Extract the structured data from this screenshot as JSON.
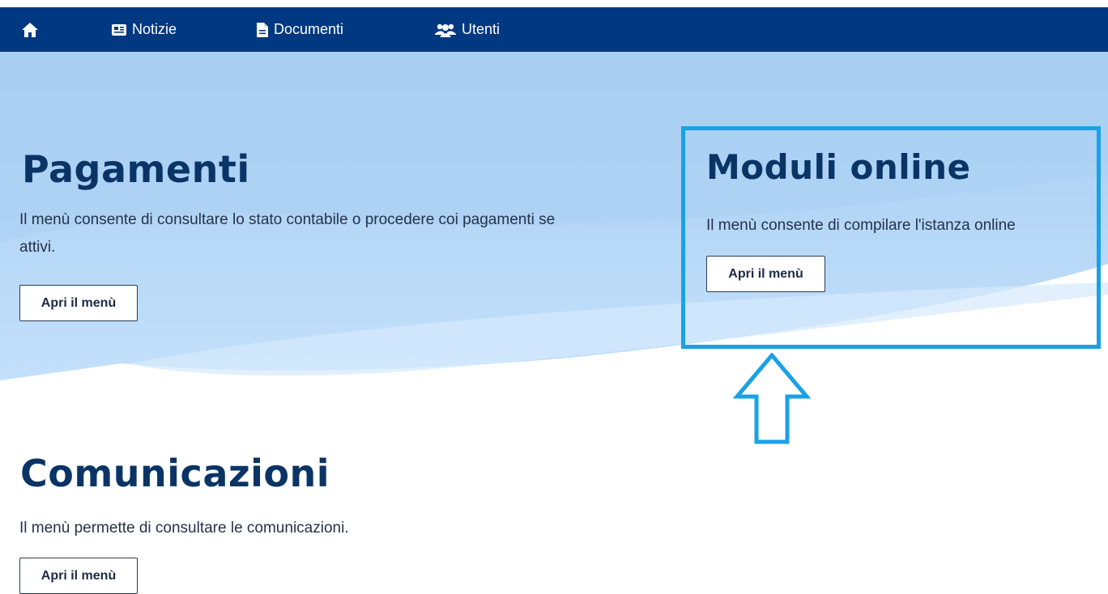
{
  "topbar": {
    "items": [
      {
        "icon": "home-icon",
        "label": ""
      },
      {
        "icon": "newspaper-icon",
        "label": "Notizie"
      },
      {
        "icon": "document-icon",
        "label": "Documenti"
      },
      {
        "icon": "users-icon",
        "label": "Utenti"
      }
    ]
  },
  "sections": {
    "pagamenti": {
      "title": "Pagamenti",
      "description": "Il menù consente di consultare lo stato contabile o procedere coi pagamenti se attivi.",
      "button": "Apri il menù"
    },
    "moduli": {
      "title": "Moduli online",
      "description": "Il menù consente di compilare l'istanza online",
      "button": "Apri il menù"
    },
    "comunicazioni": {
      "title": "Comunicazioni",
      "description": "Il menù permette di consultare le comunicazioni.",
      "button": "Apri il menù"
    }
  },
  "annotation": {
    "highlight_color": "#1aa1e6",
    "arrow_icon": "up-arrow-icon"
  },
  "colors": {
    "navbar": "#003882",
    "hero_light": "#bcdcf7",
    "title": "#0b3466"
  }
}
